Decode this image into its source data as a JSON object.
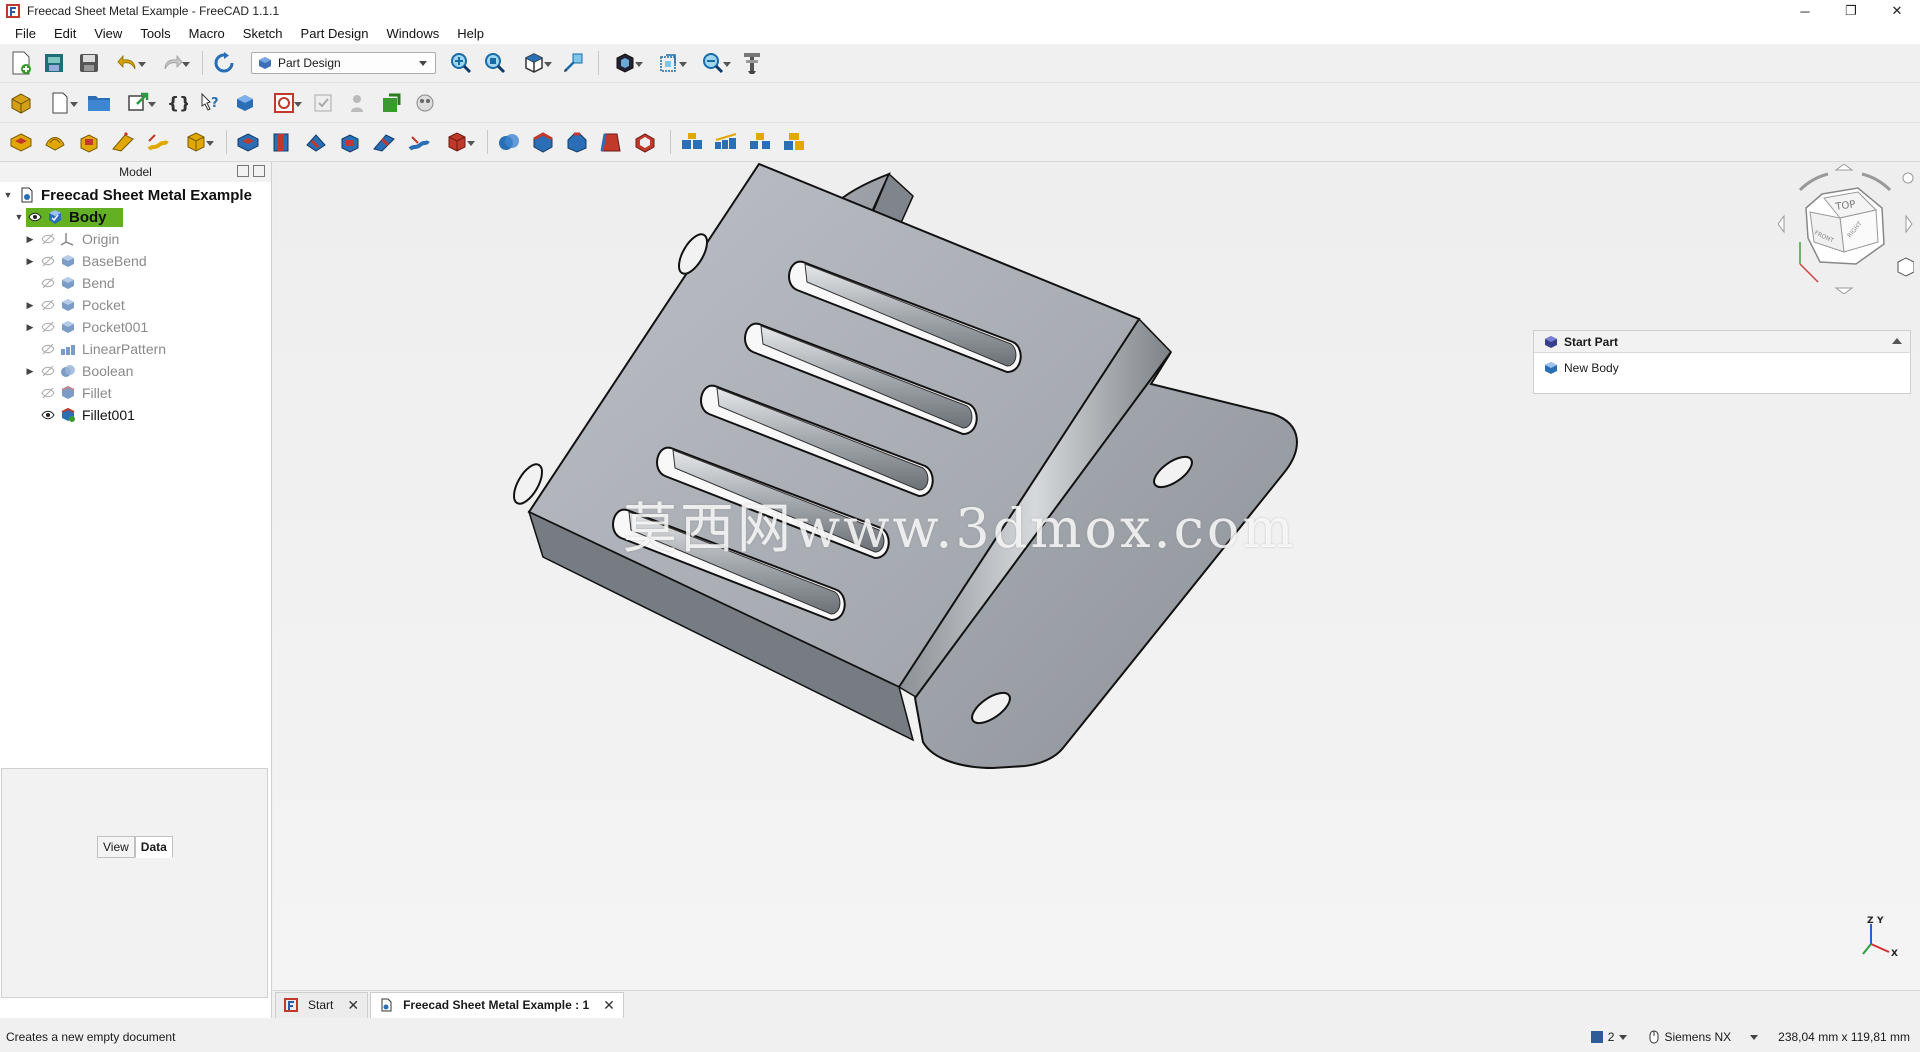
{
  "window": {
    "title": "Freecad Sheet Metal Example - FreeCAD 1.1.1",
    "minimize_glyph": "─",
    "restore_glyph": "❐",
    "close_glyph": "✕"
  },
  "menu": [
    "File",
    "Edit",
    "View",
    "Tools",
    "Macro",
    "Sketch",
    "Part Design",
    "Windows",
    "Help"
  ],
  "workbench_selector": {
    "value": "Part Design"
  },
  "model_panel": {
    "title": "Model",
    "document": "Freecad Sheet Metal Example",
    "body_label": "Body",
    "items": [
      {
        "label": "Origin"
      },
      {
        "label": "BaseBend"
      },
      {
        "label": "Bend"
      },
      {
        "label": "Pocket"
      },
      {
        "label": "Pocket001"
      },
      {
        "label": "LinearPattern"
      },
      {
        "label": "Boolean"
      },
      {
        "label": "Fillet"
      },
      {
        "label": "Fillet001"
      }
    ]
  },
  "property_tabs": {
    "view": "View",
    "data": "Data"
  },
  "watermark": "莫西网www.3dmox.com",
  "task_panel": {
    "title": "Start Part",
    "item": "New Body"
  },
  "navcube": {
    "top": "TOP",
    "front": "FRONT",
    "right": "RIGHT"
  },
  "axis": {
    "x": "X",
    "y": "Y",
    "z": "Z"
  },
  "doc_tabs": {
    "start": "Start",
    "document": "Freecad Sheet Metal Example : 1",
    "close_glyph": "✕"
  },
  "status": {
    "message": "Creates a new empty document",
    "selection_count": "2",
    "nav_style": "Siemens NX",
    "dimensions": "238,04 mm x 119,81 mm"
  }
}
